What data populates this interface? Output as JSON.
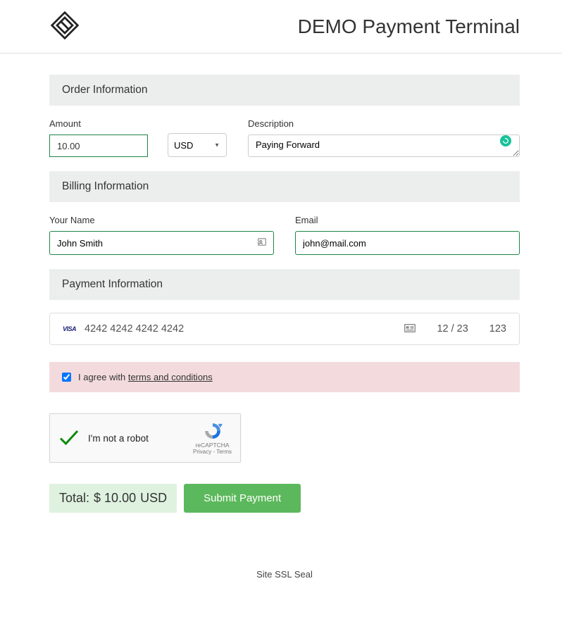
{
  "header": {
    "title": "DEMO Payment Terminal"
  },
  "sections": {
    "order": "Order Information",
    "billing": "Billing Information",
    "payment": "Payment Information"
  },
  "order": {
    "amount_label": "Amount",
    "amount_value": "10.00",
    "currency": "USD",
    "description_label": "Description",
    "description_value": "Paying Forward"
  },
  "billing": {
    "name_label": "Your Name",
    "name_value": "John Smith",
    "email_label": "Email",
    "email_value": "john@mail.com"
  },
  "card": {
    "brand": "VISA",
    "number": "4242 4242 4242 4242",
    "expiry": "12 / 23",
    "cvc": "123"
  },
  "terms": {
    "checked": true,
    "prefix": "I agree with ",
    "link_text": "terms and conditions"
  },
  "captcha": {
    "label": "I'm not a robot",
    "brand": "reCAPTCHA",
    "privacy": "Privacy",
    "terms": "Terms"
  },
  "footer": {
    "total_label": "Total: ",
    "total_amount": "$ 10.00",
    "total_currency": "USD",
    "submit": "Submit Payment",
    "ssl": "Site SSL Seal"
  }
}
